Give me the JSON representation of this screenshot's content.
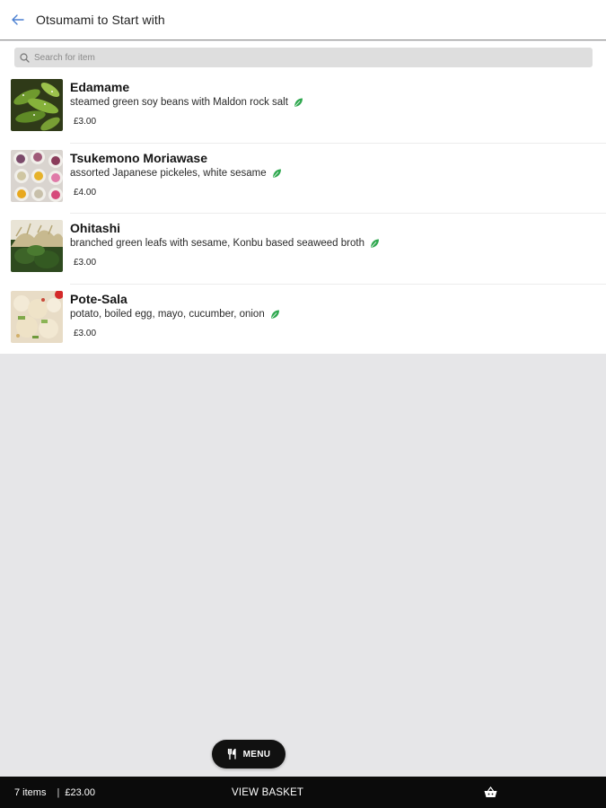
{
  "header": {
    "title": "Otsumami to Start with"
  },
  "search": {
    "placeholder": "Search for item"
  },
  "items": [
    {
      "name": "Edamame",
      "description": "steamed green soy beans with Maldon rock salt",
      "price": "£3.00"
    },
    {
      "name": "Tsukemono Moriawase",
      "description": "assorted Japanese pickeles, white sesame",
      "price": "£4.00"
    },
    {
      "name": "Ohitashi",
      "description": "branched green leafs with sesame, Konbu based seaweed broth",
      "price": "£3.00"
    },
    {
      "name": "Pote-Sala",
      "description": "potato, boiled egg, mayo, cucumber, onion",
      "price": "£3.00"
    }
  ],
  "menu_button": {
    "label": "MENU"
  },
  "basket": {
    "items_count": "7 items",
    "separator": "|",
    "total": "£23.00",
    "view_label": "VIEW BASKET"
  },
  "colors": {
    "accent_back": "#4a7fd0",
    "leaf_green": "#2fa84f",
    "bar_bg": "#0b0b0b",
    "page_bg": "#e6e6e8"
  }
}
